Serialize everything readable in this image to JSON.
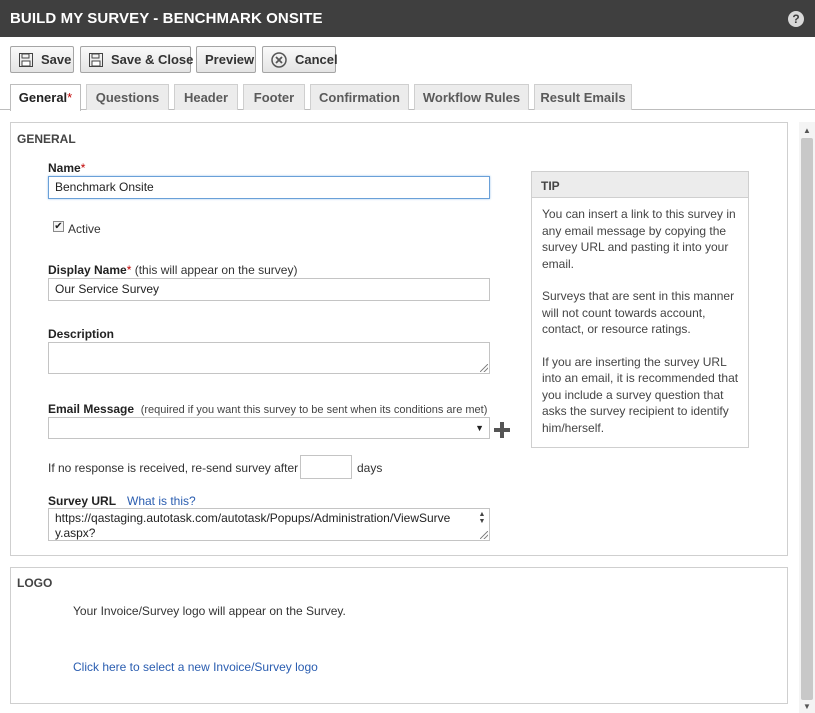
{
  "window": {
    "title": "BUILD MY SURVEY - BENCHMARK ONSITE",
    "help_icon": "?"
  },
  "toolbar": {
    "save_label": "Save",
    "save_close_label": "Save & Close",
    "preview_label": "Preview",
    "cancel_label": "Cancel"
  },
  "tabs": [
    {
      "label": "General",
      "required": "*",
      "active": true
    },
    {
      "label": "Questions"
    },
    {
      "label": "Header"
    },
    {
      "label": "Footer"
    },
    {
      "label": "Confirmation"
    },
    {
      "label": "Workflow Rules"
    },
    {
      "label": "Result Emails"
    }
  ],
  "general": {
    "section_title": "GENERAL",
    "name_label": "Name",
    "required_mark": "*",
    "name_value": "Benchmark Onsite",
    "active_label": "Active",
    "active_checked": "✔",
    "display_name_label": "Display Name",
    "display_name_note": " (this will appear on the survey)",
    "display_name_value": "Our Service Survey",
    "description_label": "Description",
    "description_value": "",
    "email_message_label": "Email Message",
    "email_message_note": "(required if you want this survey to be sent when its conditions are met)",
    "email_message_value": "",
    "resend_prefix": "If no response is received, re-send survey after",
    "resend_days_value": "",
    "resend_suffix": "days",
    "survey_url_label": "Survey URL",
    "survey_url_help_link": "What is this?",
    "survey_url_line1": "https://qastaging.autotask.com/autotask/Popups/Administration/ViewSurve",
    "survey_url_line2": "y.aspx?"
  },
  "tip": {
    "title": "TIP",
    "paragraphs": [
      "You can insert a link to this survey in any email message by copying the survey URL and pasting it into your email.",
      "Surveys that are sent in this manner will not count towards account, contact, or resource ratings.",
      "If you are inserting the survey URL into an email, it is recommended that you include a survey question that asks the survey recipient to identify him/herself."
    ]
  },
  "logo": {
    "section_title": "LOGO",
    "info_text": "Your Invoice/Survey logo will appear on the Survey.",
    "select_link": "Click here to select a new Invoice/Survey logo"
  }
}
